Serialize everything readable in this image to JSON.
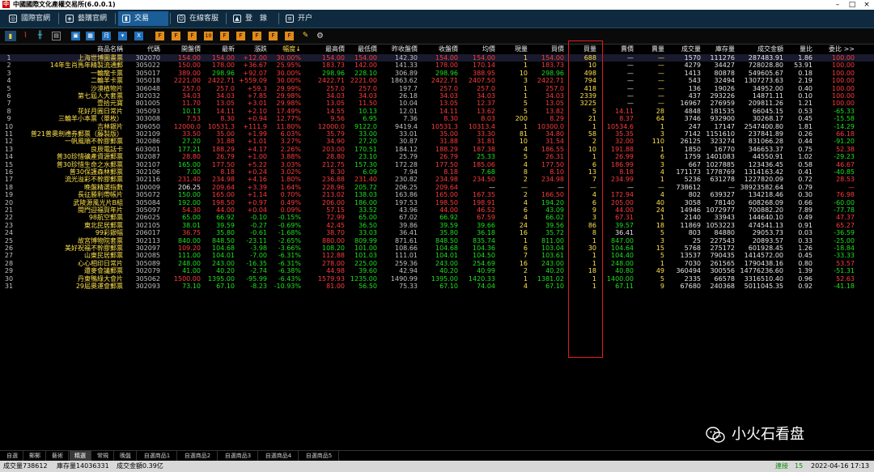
{
  "window": {
    "title": "中國國際文化產權交易所(6.0.0.1)",
    "logo_char": "中"
  },
  "nav": {
    "tabs": [
      {
        "label": "國際官網",
        "icon": "globe-icon"
      },
      {
        "label": "藝購官網",
        "icon": "shop-icon"
      },
      {
        "label": "交易",
        "icon": "trade-icon",
        "active": true
      },
      {
        "label": "在線客服",
        "icon": "chat-icon"
      },
      {
        "label": "登　錄",
        "icon": "user-icon"
      },
      {
        "label": "开户",
        "icon": "account-icon"
      }
    ]
  },
  "toolbar": {
    "letter_buttons": [
      "F",
      "F",
      "F",
      "10",
      "F",
      "F",
      "F",
      "F",
      "F"
    ]
  },
  "table": {
    "headers": [
      "商品名稱",
      "代碼",
      "開盤價",
      "最新",
      "漲跌",
      "幅度↓",
      "最高價",
      "最低價",
      "昨收盤價",
      "收盤價",
      "均價",
      "現量",
      "買價",
      "買量",
      "賣價",
      "賣量",
      "成交量",
      "庫存量",
      "成交金額",
      "量比",
      "委比 >>"
    ],
    "rows": [
      {
        "n": "1",
        "name": "上海世博圖畫票",
        "code": "302070",
        "open": "154.00",
        "last": "154.00",
        "chg": "+12.00",
        "pct": "30.00%",
        "high": "154.00",
        "low": "154.00",
        "prev": "142.30",
        "close": "154.00",
        "avg": "154.00",
        "cur": "1",
        "bid": "154.00",
        "bidv": "688",
        "ask": "—",
        "askv": "—",
        "vol": "1570",
        "inv": "111276",
        "amt": "287483.91",
        "vr": "1.86",
        "wb": "100.00"
      },
      {
        "n": "2",
        "name": "14年生肖馬年精製流通郵",
        "code": "305022",
        "open": "150.00",
        "last": "178.00",
        "chg": "+36.67",
        "pct": "25.95%",
        "high": "183.73",
        "low": "142.00",
        "prev": "141.33",
        "close": "178.00",
        "avg": "170.14",
        "cur": "1",
        "bid": "183.73",
        "bidv": "10",
        "ask": "—",
        "askv": "—",
        "vol": "4279",
        "inv": "34427",
        "amt": "728028.80",
        "vr": "53.91",
        "wb": "100.00"
      },
      {
        "n": "3",
        "name": "一輪龍卡票",
        "code": "305017",
        "open": "389.00",
        "last": "298.96",
        "chg": "+92.07",
        "pct": "30.00%",
        "high": "298.96",
        "low": "228.10",
        "prev": "306.89",
        "close": "298.96",
        "avg": "388.95",
        "cur": "10",
        "bid": "298.96",
        "bidv": "498",
        "ask": "—",
        "askv": "—",
        "vol": "1413",
        "inv": "80878",
        "amt": "549605.67",
        "vr": "0.18",
        "wb": "100.00"
      },
      {
        "n": "4",
        "name": "二輪羊卡票",
        "code": "305018",
        "open": "2221.00",
        "last": "2422.71",
        "chg": "+559.09",
        "pct": "30.00%",
        "high": "2422.71",
        "low": "2221.00",
        "prev": "1863.62",
        "close": "2422.71",
        "avg": "2407.50",
        "cur": "3",
        "bid": "2422.71",
        "bidv": "794",
        "ask": "—",
        "askv": "—",
        "vol": "543",
        "inv": "32494",
        "amt": "1307273.63",
        "vr": "2.19",
        "wb": "100.00"
      },
      {
        "n": "5",
        "name": "沙漠植物片",
        "code": "306048",
        "open": "257.0",
        "last": "257.0",
        "chg": "+59.3",
        "pct": "29.99%",
        "high": "257.0",
        "low": "257.0",
        "prev": "197.7",
        "close": "257.0",
        "avg": "257.0",
        "cur": "1",
        "bid": "257.0",
        "bidv": "418",
        "ask": "—",
        "askv": "—",
        "vol": "136",
        "inv": "19026",
        "amt": "34952.00",
        "vr": "0.40",
        "wb": "100.00"
      },
      {
        "n": "6",
        "name": "第七屆人大套票",
        "code": "302032",
        "open": "34.03",
        "last": "34.03",
        "chg": "+7.85",
        "pct": "29.98%",
        "high": "34.03",
        "low": "34.03",
        "prev": "26.18",
        "close": "34.03",
        "avg": "34.03",
        "cur": "1",
        "bid": "34.03",
        "bidv": "2339",
        "ask": "—",
        "askv": "—",
        "vol": "437",
        "inv": "293226",
        "amt": "14871.11",
        "vr": "0.10",
        "wb": "100.00"
      },
      {
        "n": "7",
        "name": "壹拾元寶",
        "code": "801005",
        "open": "11.70",
        "last": "13.05",
        "chg": "+3.01",
        "pct": "29.98%",
        "high": "13.05",
        "low": "11.50",
        "prev": "10.04",
        "close": "13.05",
        "avg": "12.37",
        "cur": "5",
        "bid": "13.05",
        "bidv": "3225",
        "ask": "—",
        "askv": "—",
        "vol": "16967",
        "inv": "276959",
        "amt": "209811.26",
        "vr": "1.21",
        "wb": "100.00"
      },
      {
        "n": "8",
        "name": "花好月圓日常片",
        "code": "305093",
        "open": "10.13",
        "last": "14.11",
        "chg": "+2.10",
        "pct": "17.49%",
        "high": "14.55",
        "low": "10.13",
        "prev": "12.01",
        "close": "14.11",
        "avg": "13.62",
        "cur": "5",
        "bid": "13.82",
        "bidv": "5",
        "ask": "14.11",
        "askv": "28",
        "vol": "4848",
        "inv": "181535",
        "amt": "66045.15",
        "vr": "0.53",
        "wb": "-65.33"
      },
      {
        "n": "9",
        "name": "三輪羊小本票（單枚）",
        "code": "303008",
        "open": "7.53",
        "last": "8.30",
        "chg": "+0.94",
        "pct": "12.77%",
        "high": "9.56",
        "low": "6.95",
        "prev": "7.36",
        "close": "8.30",
        "avg": "8.03",
        "cur": "200",
        "bid": "8.29",
        "bidv": "21",
        "ask": "8.37",
        "askv": "64",
        "vol": "3746",
        "inv": "932900",
        "amt": "30268.17",
        "vr": "0.45",
        "wb": "-15.58"
      },
      {
        "n": "10",
        "name": "吉林銀片",
        "code": "306050",
        "open": "12000.0",
        "last": "10531.3",
        "chg": "+111.9",
        "pct": "11.80%",
        "high": "12000.0",
        "low": "9122.0",
        "prev": "9419.4",
        "close": "10531.3",
        "avg": "10313.4",
        "cur": "1",
        "bid": "10300.0",
        "bidv": "1",
        "ask": "10534.6",
        "askv": "1",
        "vol": "247",
        "inv": "17147",
        "amt": "2547400.80",
        "vr": "1.81",
        "wb": "-14.29"
      },
      {
        "n": "11",
        "name": "普21普奧劍禮券郵票（藤製版）",
        "code": "302109",
        "open": "33.50",
        "last": "35.00",
        "chg": "+1.99",
        "pct": "6.03%",
        "high": "35.79",
        "low": "33.00",
        "prev": "33.01",
        "close": "35.00",
        "avg": "33.30",
        "cur": "81",
        "bid": "34.80",
        "bidv": "58",
        "ask": "35.35",
        "askv": "3",
        "vol": "7142",
        "inv": "1151610",
        "amt": "237841.89",
        "vr": "0.26",
        "wb": "66.18"
      },
      {
        "n": "12",
        "name": "一帆風順不幹膠郵票",
        "code": "302086",
        "open": "27.20",
        "last": "31.88",
        "chg": "+1.01",
        "pct": "3.27%",
        "high": "34.90",
        "low": "27.20",
        "prev": "30.87",
        "close": "31.88",
        "avg": "31.81",
        "cur": "10",
        "bid": "31.54",
        "bidv": "2",
        "ask": "32.00",
        "askv": "110",
        "vol": "26125",
        "inv": "323274",
        "amt": "831066.28",
        "vr": "0.44",
        "wb": "-91.20"
      },
      {
        "n": "13",
        "name": "良辰電話卡",
        "code": "603001",
        "open": "177.21",
        "last": "188.29",
        "chg": "+4.17",
        "pct": "2.26%",
        "high": "203.00",
        "low": "170.51",
        "prev": "184.12",
        "close": "188.29",
        "avg": "187.38",
        "cur": "4",
        "bid": "186.55",
        "bidv": "10",
        "ask": "191.88",
        "askv": "1",
        "vol": "1850",
        "inv": "16770",
        "amt": "346653.37",
        "vr": "0.75",
        "wb": "52.38"
      },
      {
        "n": "14",
        "name": "普30珍惜礦產資源郵票",
        "code": "302087",
        "open": "28.80",
        "last": "26.79",
        "chg": "+1.00",
        "pct": "3.88%",
        "high": "28.80",
        "low": "23.10",
        "prev": "25.79",
        "close": "26.79",
        "avg": "25.33",
        "cur": "5",
        "bid": "26.31",
        "bidv": "1",
        "ask": "26.99",
        "askv": "6",
        "vol": "1759",
        "inv": "1401083",
        "amt": "44550.91",
        "vr": "1.02",
        "wb": "-29.23"
      },
      {
        "n": "15",
        "name": "普30珍惜生命之水郵票",
        "code": "302107",
        "open": "165.00",
        "last": "177.50",
        "chg": "+5.22",
        "pct": "3.03%",
        "high": "212.75",
        "low": "157.30",
        "prev": "172.28",
        "close": "177.50",
        "avg": "185.06",
        "cur": "4",
        "bid": "177.50",
        "bidv": "6",
        "ask": "186.99",
        "askv": "3",
        "vol": "667",
        "inv": "1027885",
        "amt": "123436.45",
        "vr": "0.58",
        "wb": "46.67"
      },
      {
        "n": "16",
        "name": "普30保護森林郵票",
        "code": "302106",
        "open": "7.00",
        "last": "8.18",
        "chg": "+0.24",
        "pct": "3.02%",
        "high": "8.30",
        "low": "6.09",
        "prev": "7.94",
        "close": "8.18",
        "avg": "7.68",
        "cur": "8",
        "bid": "8.10",
        "bidv": "13",
        "ask": "8.18",
        "askv": "4",
        "vol": "171173",
        "inv": "1778769",
        "amt": "1314163.42",
        "vr": "0.41",
        "wb": "-40.85"
      },
      {
        "n": "17",
        "name": "流光溢彩不幹膠郵票",
        "code": "302116",
        "open": "231.40",
        "last": "234.98",
        "chg": "+4.16",
        "pct": "1.80%",
        "high": "236.88",
        "low": "231.40",
        "prev": "230.82",
        "close": "234.98",
        "avg": "234.50",
        "cur": "2",
        "bid": "234.98",
        "bidv": "7",
        "ask": "234.99",
        "askv": "1",
        "vol": "5236",
        "inv": "631278",
        "amt": "1227820.09",
        "vr": "0.72",
        "wb": "28.53"
      },
      {
        "n": "18",
        "name": "晚盤精選指數",
        "code": "100009",
        "open": "206.25",
        "last": "209.64",
        "chg": "+3.39",
        "pct": "1.64%",
        "high": "228.96",
        "low": "205.72",
        "prev": "206.25",
        "close": "209.64",
        "avg": "—",
        "cur": "—",
        "bid": "—",
        "bidv": "—",
        "ask": "—",
        "askv": "—",
        "vol": "738612",
        "inv": "—",
        "amt": "38923582.64",
        "vr": "0.79",
        "wb": "—"
      },
      {
        "n": "19",
        "name": "長征勝利帶帳片",
        "code": "305072",
        "open": "150.00",
        "last": "165.00",
        "chg": "+1.14",
        "pct": "0.70%",
        "high": "213.02",
        "low": "138.03",
        "prev": "163.86",
        "close": "165.00",
        "avg": "167.35",
        "cur": "2",
        "bid": "166.50",
        "bidv": "4",
        "ask": "172.94",
        "askv": "4",
        "vol": "802",
        "inv": "639327",
        "amt": "134218.46",
        "vr": "0.30",
        "wb": "76.98"
      },
      {
        "n": "20",
        "name": "武陵源風光片B組",
        "code": "305084",
        "open": "192.00",
        "last": "198.50",
        "chg": "+0.97",
        "pct": "0.49%",
        "high": "206.00",
        "low": "186.00",
        "prev": "197.53",
        "close": "198.50",
        "avg": "198.91",
        "cur": "4",
        "bid": "194.20",
        "bidv": "6",
        "ask": "205.00",
        "askv": "40",
        "vol": "3058",
        "inv": "78140",
        "amt": "608268.09",
        "vr": "0.66",
        "wb": "-60.00"
      },
      {
        "n": "21",
        "name": "閩門迎福賀年片",
        "code": "305097",
        "open": "54.30",
        "last": "44.00",
        "chg": "+0.04",
        "pct": "0.09%",
        "high": "57.15",
        "low": "33.52",
        "prev": "43.96",
        "close": "44.00",
        "avg": "46.52",
        "cur": "6",
        "bid": "43.09",
        "bidv": "9",
        "ask": "44.00",
        "askv": "24",
        "vol": "14946",
        "inv": "1072977",
        "amt": "700882.20",
        "vr": "7.89",
        "wb": "-77.78"
      },
      {
        "n": "22",
        "name": "98航空郵票",
        "code": "206025",
        "open": "65.00",
        "last": "66.92",
        "chg": "-0.10",
        "pct": "-0.15%",
        "high": "72.99",
        "low": "65.00",
        "prev": "67.02",
        "close": "66.92",
        "avg": "67.59",
        "cur": "4",
        "bid": "66.02",
        "bidv": "3",
        "ask": "67.31",
        "askv": "1",
        "vol": "2140",
        "inv": "33943",
        "amt": "144640.10",
        "vr": "0.49",
        "wb": "47.37"
      },
      {
        "n": "23",
        "name": "東北民居郵票",
        "code": "302105",
        "open": "38.01",
        "last": "39.59",
        "chg": "-0.27",
        "pct": "-0.69%",
        "high": "42.45",
        "low": "36.50",
        "prev": "39.86",
        "close": "39.59",
        "avg": "39.66",
        "cur": "24",
        "bid": "39.56",
        "bidv": "86",
        "ask": "39.57",
        "askv": "18",
        "vol": "11869",
        "inv": "1053223",
        "amt": "474541.13",
        "vr": "0.91",
        "wb": "65.27"
      },
      {
        "n": "24",
        "name": "99彩銀幅",
        "code": "206017",
        "open": "36.75",
        "last": "35.80",
        "chg": "-0.61",
        "pct": "-1.68%",
        "high": "38.70",
        "low": "33.03",
        "prev": "36.41",
        "close": "35.80",
        "avg": "36.18",
        "cur": "16",
        "bid": "35.72",
        "bidv": "8",
        "ask": "36.41",
        "askv": "5",
        "vol": "803",
        "inv": "84880",
        "amt": "29053.73",
        "vr": "0.03",
        "wb": "-36.59"
      },
      {
        "n": "25",
        "name": "故宮博物院套票",
        "code": "302113",
        "open": "840.00",
        "last": "848.50",
        "chg": "-23.11",
        "pct": "-2.65%",
        "high": "880.00",
        "low": "809.99",
        "prev": "871.61",
        "close": "848.50",
        "avg": "835.74",
        "cur": "1",
        "bid": "811.00",
        "bidv": "1",
        "ask": "847.00",
        "askv": "3",
        "vol": "25",
        "inv": "227543",
        "amt": "20893.57",
        "vr": "0.33",
        "wb": "-25.00"
      },
      {
        "n": "26",
        "name": "美好祝福不幹膠郵票",
        "code": "302097",
        "open": "109.20",
        "last": "104.68",
        "chg": "-3.98",
        "pct": "-3.66%",
        "high": "108.20",
        "low": "101.00",
        "prev": "108.66",
        "close": "104.68",
        "avg": "104.36",
        "cur": "6",
        "bid": "103.04",
        "bidv": "30",
        "ask": "104.64",
        "askv": "15",
        "vol": "5768",
        "inv": "275172",
        "amt": "601928.45",
        "vr": "1.26",
        "wb": "-18.84"
      },
      {
        "n": "27",
        "name": "山東民居郵票",
        "code": "302085",
        "open": "111.00",
        "last": "104.01",
        "chg": "-7.00",
        "pct": "-6.31%",
        "high": "112.88",
        "low": "101.03",
        "prev": "111.01",
        "close": "104.01",
        "avg": "104.50",
        "cur": "7",
        "bid": "103.61",
        "bidv": "1",
        "ask": "104.40",
        "askv": "5",
        "vol": "13537",
        "inv": "790435",
        "amt": "1414572.00",
        "vr": "0.45",
        "wb": "-33.33"
      },
      {
        "n": "28",
        "name": "心心相印日常片",
        "code": "305089",
        "open": "248.00",
        "last": "243.00",
        "chg": "-16.35",
        "pct": "-6.31%",
        "high": "278.00",
        "low": "225.00",
        "prev": "259.36",
        "close": "243.00",
        "avg": "254.69",
        "cur": "16",
        "bid": "243.00",
        "bidv": "1",
        "ask": "248.00",
        "askv": "1",
        "vol": "7030",
        "inv": "261565",
        "amt": "1790438.16",
        "vr": "0.80",
        "wb": "53.57"
      },
      {
        "n": "29",
        "name": "還麥會議郵票",
        "code": "302079",
        "open": "41.00",
        "last": "40.20",
        "chg": "-2.74",
        "pct": "-6.38%",
        "high": "44.98",
        "low": "39.60",
        "prev": "42.94",
        "close": "40.20",
        "avg": "40.99",
        "cur": "2",
        "bid": "40.20",
        "bidv": "18",
        "ask": "40.80",
        "askv": "49",
        "vol": "360494",
        "inv": "300556",
        "amt": "14776236.60",
        "vr": "1.39",
        "wb": "-51.31"
      },
      {
        "n": "30",
        "name": "丹東鴨綠大會片",
        "code": "305062",
        "open": "1500.00",
        "last": "1395.00",
        "chg": "-95.99",
        "pct": "-6.43%",
        "high": "1579.93",
        "low": "1235.00",
        "prev": "1490.99",
        "close": "1395.00",
        "avg": "1420.33",
        "cur": "1",
        "bid": "1381.02",
        "bidv": "1",
        "ask": "1400.00",
        "askv": "5",
        "vol": "2335",
        "inv": "66578",
        "amt": "3316510.40",
        "vr": "0.96",
        "wb": "52.63"
      },
      {
        "n": "31",
        "name": "29屆奧運會郵票",
        "code": "302093",
        "open": "73.10",
        "last": "67.10",
        "chg": "-8.23",
        "pct": "-10.93%",
        "high": "81.00",
        "low": "56.50",
        "prev": "75.33",
        "close": "67.10",
        "avg": "74.04",
        "cur": "4",
        "bid": "67.10",
        "bidv": "1",
        "ask": "67.11",
        "askv": "9",
        "vol": "67680",
        "inv": "240368",
        "amt": "5011045.35",
        "vr": "0.92",
        "wb": "-41.18"
      }
    ]
  },
  "watermark": {
    "text": "小火石看盘",
    "icon": "wechat-icon"
  },
  "bottom_tabs": [
    "自選",
    "郵郵",
    "藝術",
    "精選",
    "常規",
    "晚盤",
    "自選商品1",
    "自選商品2",
    "自選商品3",
    "自選商品4",
    "自選商品5"
  ],
  "bottom_active": "精選",
  "status": {
    "volume": "成交量738612",
    "inventory": "庫存量14036331",
    "amount": "成交金額0.39亿",
    "connection": "連接",
    "conn_count": "15",
    "datetime": "2022-04-16 17:13"
  },
  "colors": {
    "up": "#ff3b3b",
    "down": "#1ee01e",
    "flat": "#e6e6e6",
    "highlight_box": "#e81919",
    "nav_bg": "#0f2a3e",
    "nav_active": "#1b5d96"
  }
}
